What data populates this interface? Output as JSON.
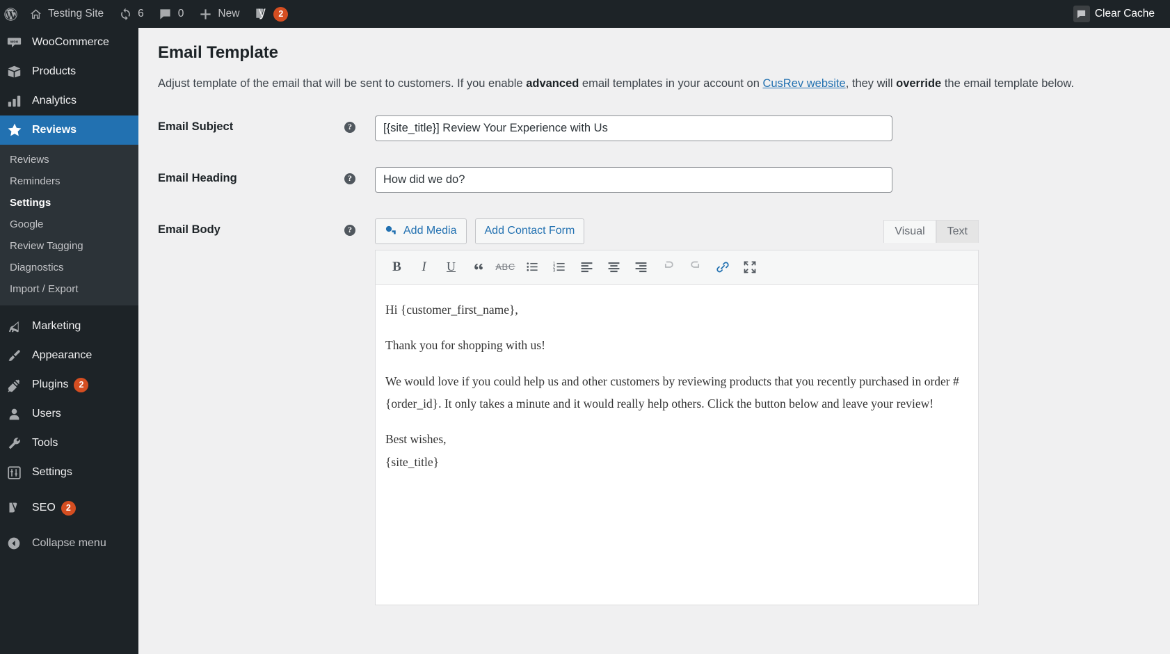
{
  "adminbar": {
    "logo_icon": "wordpress-logo-icon",
    "home_icon": "home-icon",
    "site_name": "Testing Site",
    "updates_icon": "updates-icon",
    "updates_count": "6",
    "comments_icon": "comment-bubble-icon",
    "comments_count": "0",
    "new_icon": "plus-icon",
    "new_label": "New",
    "seo_icon": "yoast-seo-icon",
    "seo_count": "2",
    "cache_icon": "comment-bubble-icon",
    "clear_cache_label": "Clear Cache"
  },
  "sidebar": {
    "items": [
      {
        "label": "WooCommerce",
        "icon": "woocommerce-icon",
        "current": false
      },
      {
        "label": "Products",
        "icon": "products-box-icon",
        "current": false
      },
      {
        "label": "Analytics",
        "icon": "analytics-bars-icon",
        "current": false
      },
      {
        "label": "Reviews",
        "icon": "star-icon",
        "current": true
      }
    ],
    "submenu": [
      {
        "label": "Reviews",
        "current": false
      },
      {
        "label": "Reminders",
        "current": false
      },
      {
        "label": "Settings",
        "current": true
      },
      {
        "label": "Google",
        "current": false
      },
      {
        "label": "Review Tagging",
        "current": false
      },
      {
        "label": "Diagnostics",
        "current": false
      },
      {
        "label": "Import / Export",
        "current": false
      }
    ],
    "items_lower": [
      {
        "label": "Marketing",
        "icon": "megaphone-icon",
        "badge": ""
      },
      {
        "label": "Appearance",
        "icon": "paintbrush-icon",
        "badge": ""
      },
      {
        "label": "Plugins",
        "icon": "plug-icon",
        "badge": "2"
      },
      {
        "label": "Users",
        "icon": "user-icon",
        "badge": ""
      },
      {
        "label": "Tools",
        "icon": "wrench-icon",
        "badge": ""
      },
      {
        "label": "Settings",
        "icon": "sliders-icon",
        "badge": ""
      },
      {
        "label": "SEO",
        "icon": "yoast-seo-icon",
        "badge": "2"
      }
    ],
    "collapse": {
      "label": "Collapse menu",
      "icon": "collapse-arrow-icon"
    }
  },
  "page": {
    "title": "Email Template",
    "desc_part1": "Adjust template of the email that will be sent to customers. If you enable ",
    "desc_bold1": "advanced",
    "desc_part2": " email templates in your account on ",
    "desc_link": "CusRev website",
    "desc_part3": ", they will ",
    "desc_bold2": "override",
    "desc_part4": " the email template below.",
    "help_glyph": "?"
  },
  "form": {
    "subject": {
      "label": "Email Subject",
      "value": "[{site_title}] Review Your Experience with Us"
    },
    "heading": {
      "label": "Email Heading",
      "value": "How did we do?"
    },
    "body": {
      "label": "Email Body",
      "add_media_label": "Add Media",
      "add_media_icon": "media-icon",
      "add_contact_form_label": "Add Contact Form",
      "tab_visual": "Visual",
      "tab_text": "Text",
      "active_tab": "Visual",
      "toolbar": [
        {
          "name": "bold-icon",
          "glyph": "B",
          "disabled": false
        },
        {
          "name": "italic-icon",
          "glyph": "I",
          "disabled": false
        },
        {
          "name": "underline-icon",
          "glyph": "U",
          "disabled": false
        },
        {
          "name": "blockquote-icon",
          "glyph": "“",
          "disabled": false
        },
        {
          "name": "strikethrough-icon",
          "glyph": "ABC",
          "disabled": false
        },
        {
          "name": "bulleted-list-icon",
          "glyph": "",
          "disabled": false
        },
        {
          "name": "numbered-list-icon",
          "glyph": "",
          "disabled": false
        },
        {
          "name": "align-left-icon",
          "glyph": "",
          "disabled": false
        },
        {
          "name": "align-center-icon",
          "glyph": "",
          "disabled": false
        },
        {
          "name": "align-right-icon",
          "glyph": "",
          "disabled": false
        },
        {
          "name": "undo-icon",
          "glyph": "",
          "disabled": true
        },
        {
          "name": "redo-icon",
          "glyph": "",
          "disabled": true
        },
        {
          "name": "insert-link-icon",
          "glyph": "",
          "disabled": false
        },
        {
          "name": "fullscreen-icon",
          "glyph": "",
          "disabled": false
        }
      ],
      "content": [
        "Hi {customer_first_name},",
        "Thank you for shopping with us!",
        "We would love if you could help us and other customers by reviewing products that you recently purchased in order #{order_id}. It only takes a minute and it would really help others. Click the button below and leave your review!",
        "Best wishes,",
        "{site_title}"
      ]
    }
  },
  "colors": {
    "admin_bar_bg": "#1d2327",
    "sidebar_bg": "#1d2327",
    "submenu_bg": "#2c3338",
    "accent_blue": "#2271b1",
    "badge_red": "#d63638",
    "badge_orange": "#d54e21",
    "content_bg": "#f0f0f1"
  }
}
